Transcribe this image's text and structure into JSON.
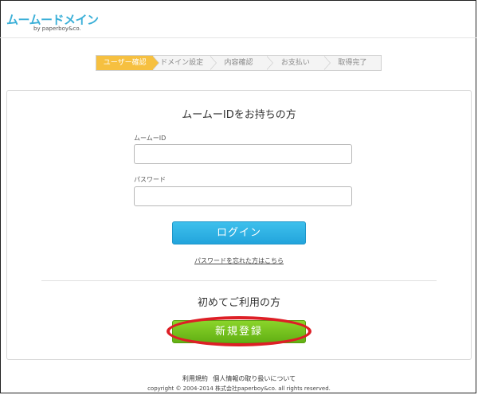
{
  "header": {
    "logo_text": "ムームードメイン",
    "logo_sub": "by paperboy&co."
  },
  "steps": [
    {
      "label": "ユーザー確認",
      "active": true
    },
    {
      "label": "ドメイン設定",
      "active": false
    },
    {
      "label": "内容確認",
      "active": false
    },
    {
      "label": "お支払い",
      "active": false
    },
    {
      "label": "取得完了",
      "active": false
    }
  ],
  "login": {
    "title": "ムームーIDをお持ちの方",
    "id_label": "ムームーID",
    "id_value": "",
    "password_label": "パスワード",
    "password_value": "",
    "button_label": "ログイン",
    "forgot_link": "パスワードを忘れた方はこちら"
  },
  "register": {
    "title": "初めてご利用の方",
    "button_label": "新規登録",
    "highlight_color": "#dd1f26"
  },
  "footer": {
    "terms": "利用規約",
    "privacy": "個人情報の取り扱いについて",
    "copyright": "copyright © 2004-2014 株式会社paperboy&co. all rights reserved."
  },
  "colors": {
    "step_active": "#f6c040",
    "login_button": "#2eb2e6",
    "register_button": "#72c21e"
  }
}
